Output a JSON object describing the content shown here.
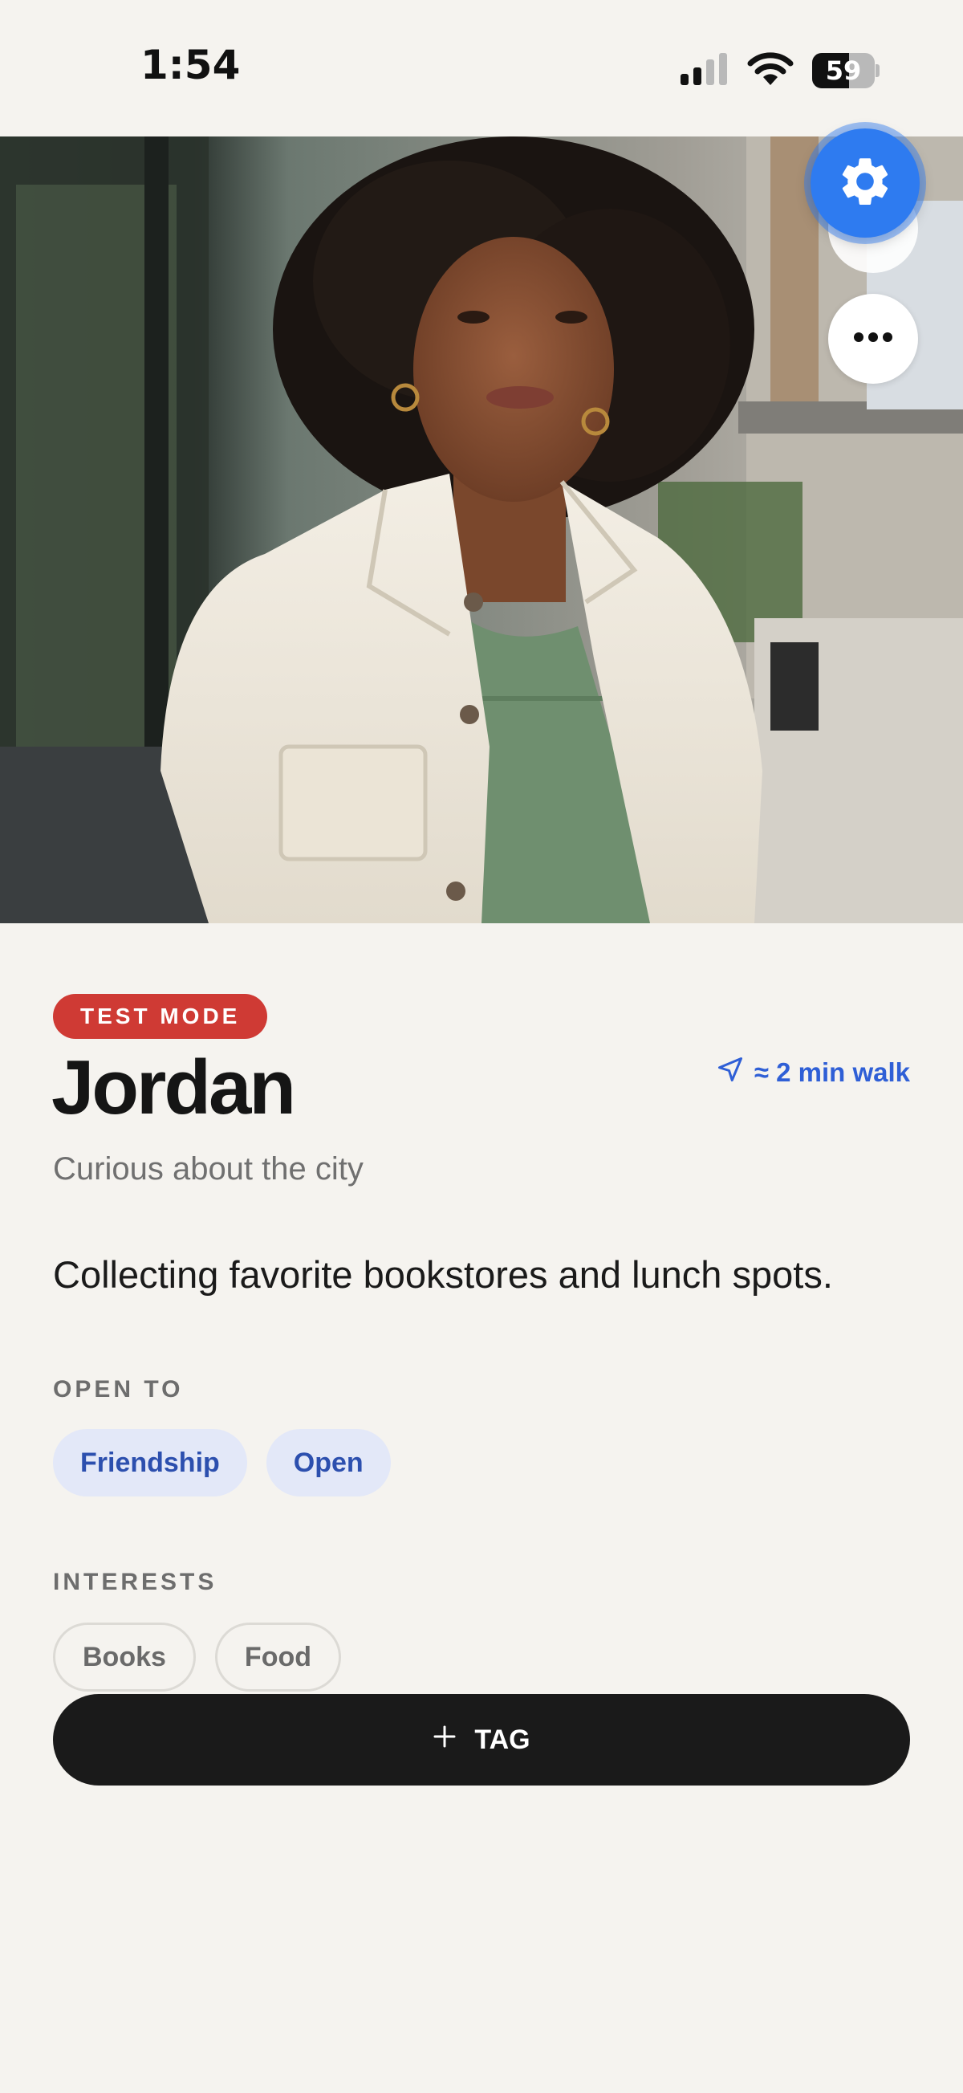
{
  "status_bar": {
    "time": "1:54",
    "battery_level": "59",
    "battery_fraction": 0.59
  },
  "profile": {
    "mode_badge": "TEST MODE",
    "name": "Jordan",
    "distance": "≈ 2 min walk",
    "tagline": "Curious about the city",
    "bio": "Collecting favorite bookstores and lunch spots."
  },
  "open_to": {
    "label": "OPEN TO",
    "items": [
      "Friendship",
      "Open"
    ]
  },
  "interests": {
    "label": "INTERESTS",
    "items": [
      "Books",
      "Food"
    ]
  },
  "action": {
    "tag_label": "TAG"
  },
  "colors": {
    "accent_blue": "#2f5fd6",
    "badge_red": "#cf3a34",
    "settings_fab": "#2e7bf0",
    "background": "#f5f3ef",
    "primary_button": "#1a1a1a"
  },
  "icons": {
    "settings": "gear-icon",
    "more": "more-horizontal-icon",
    "distance": "navigation-arrow-icon",
    "add": "plus-icon"
  }
}
